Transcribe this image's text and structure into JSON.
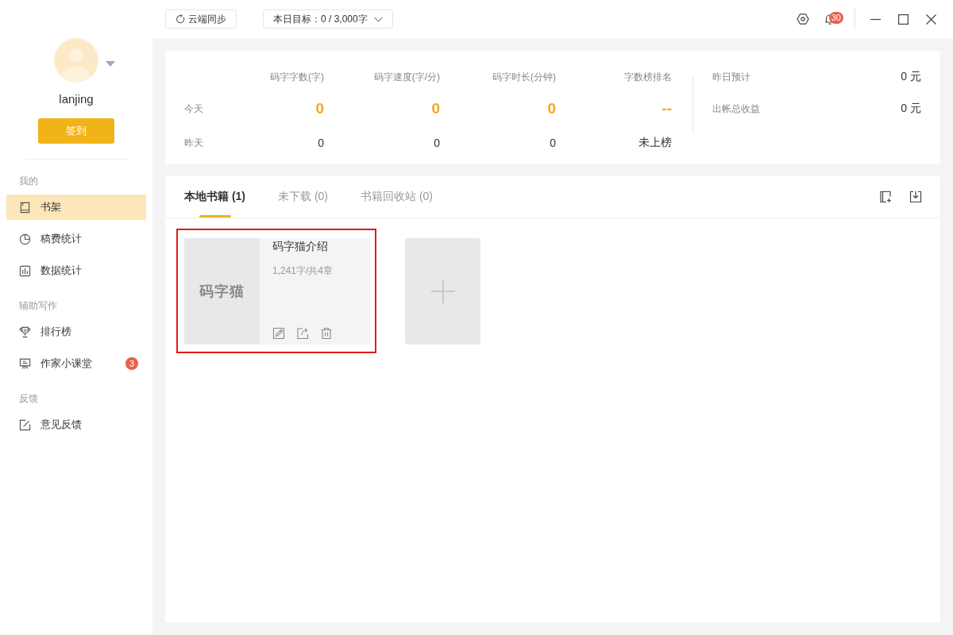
{
  "topbar": {
    "sync_button": "云端同步",
    "daily_goal": "本日目标：0 / 3,000字",
    "notification_count": "30"
  },
  "sidebar": {
    "username": "lanjing",
    "checkin_button": "签到",
    "sections": [
      {
        "title": "我的",
        "items": [
          {
            "label": "书架",
            "selected": true
          },
          {
            "label": "稿费统计",
            "selected": false
          },
          {
            "label": "数据统计",
            "selected": false
          }
        ]
      },
      {
        "title": "辅助写作",
        "items": [
          {
            "label": "排行榜",
            "selected": false
          },
          {
            "label": "作家小课堂",
            "selected": false,
            "badge": "3"
          }
        ]
      },
      {
        "title": "反馈",
        "items": [
          {
            "label": "意见反馈",
            "selected": false
          }
        ]
      }
    ]
  },
  "stats": {
    "columns": [
      "码字字数(字)",
      "码字速度(字/分)",
      "码字时长(分钟)",
      "字数榜排名"
    ],
    "rows": [
      {
        "label": "今天",
        "kind": "highlight",
        "values": [
          "0",
          "0",
          "0",
          "--"
        ]
      },
      {
        "label": "昨天",
        "kind": "plain",
        "values": [
          "0",
          "0",
          "0",
          "未上榜"
        ]
      }
    ],
    "earnings": [
      {
        "label": "昨日预计",
        "value": "0 元"
      },
      {
        "label": "出帐总收益",
        "value": "0 元"
      }
    ]
  },
  "library": {
    "tabs": [
      {
        "label": "本地书籍 (1)",
        "selected": true
      },
      {
        "label": "未下载 (0)",
        "selected": false
      },
      {
        "label": "书籍回收站 (0)",
        "selected": false
      }
    ],
    "books": [
      {
        "title": "码字猫介绍",
        "cover_logo": "码字猫",
        "meta": "1,241字/共4章",
        "highlighted": true
      }
    ]
  }
}
